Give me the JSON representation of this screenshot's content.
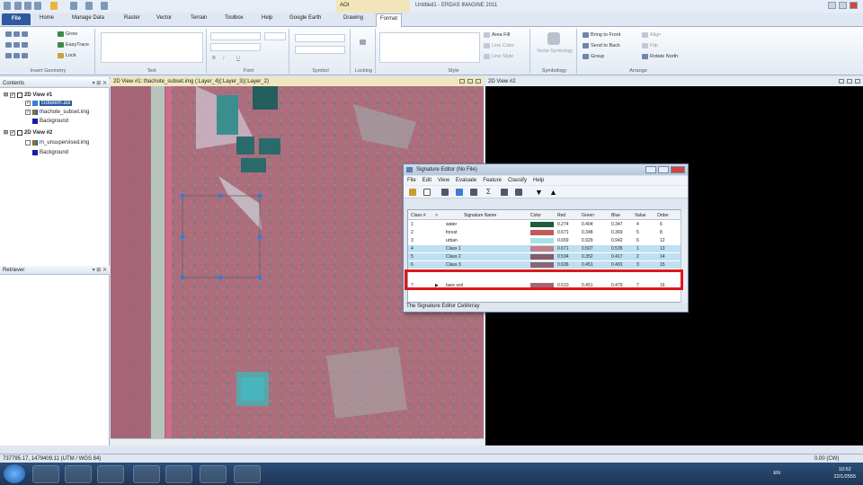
{
  "app": {
    "title": "Untitled1 - ERDAS IMAGINE 2011",
    "context_tab": "AOI"
  },
  "tabs": [
    "File",
    "Home",
    "Manage Data",
    "Raster",
    "Vector",
    "Terrain",
    "Toolbox",
    "Help",
    "Google Earth",
    "Drawing",
    "Format"
  ],
  "ribbon": {
    "insert_geometry": {
      "grow": "Grow",
      "easytrace": "EasyTrace",
      "lock": "Lock",
      "label": "Insert Geometry"
    },
    "text_label": "Text",
    "font_label": "Font",
    "font_b": "B",
    "font_i": "I",
    "font_u": "U",
    "symbol_label": "Symbol",
    "locking_label": "Locking",
    "style": {
      "area_fill": "Area Fill",
      "line_color": "Line Color",
      "line_style": "Line Style",
      "label": "Style"
    },
    "symbology": {
      "vector_symbology": "Vector Symbology",
      "label": "Symbology"
    },
    "arrange": {
      "bring_to_front": "Bring to Front",
      "send_to_back": "Send to Back",
      "group": "Group",
      "align": "Align",
      "flip": "Flip",
      "rotate_north": "Rotate North",
      "label": "Arrange"
    }
  },
  "contents": {
    "header": "Contents",
    "items": [
      {
        "label": "2D View #1",
        "level": 0
      },
      {
        "label": "Gotelem.aoi",
        "level": 1
      },
      {
        "label": "thachote_subset.img",
        "level": 1
      },
      {
        "label": "Background",
        "level": 1
      },
      {
        "label": "2D View #2",
        "level": 0
      },
      {
        "label": "m_unsupervised.img",
        "level": 1
      },
      {
        "label": "Background",
        "level": 1
      }
    ]
  },
  "retriever": {
    "header": "Retriever"
  },
  "view1": {
    "header": "2D View #1: thachote_subset.img (:Layer_4)(:Layer_3)(:Layer_2)"
  },
  "view2": {
    "header": "2D View #2"
  },
  "sig_editor": {
    "title": "Signature Editor (No File)",
    "menu": [
      "File",
      "Edit",
      "View",
      "Evaluate",
      "Feature",
      "Classify",
      "Help"
    ],
    "columns": [
      "Class #",
      ">",
      "Signature Name",
      "Color",
      "Red",
      "Green",
      "Blue",
      "Value",
      "Order"
    ],
    "rows": [
      {
        "num": "1",
        "sel": "",
        "name": "water",
        "color": "#1f5a3a",
        "red": "0.274",
        "green": "0.404",
        "blue": "0.347",
        "value": "4",
        "order": "6"
      },
      {
        "num": "2",
        "sel": "",
        "name": "forest",
        "color": "#c45a5a",
        "red": "0.671",
        "green": "0.348",
        "blue": "0.369",
        "value": "5",
        "order": "8"
      },
      {
        "num": "3",
        "sel": "",
        "name": "urban",
        "color": "#a8e3e8",
        "red": "0.659",
        "green": "0.929",
        "blue": "0.942",
        "value": "6",
        "order": "12"
      },
      {
        "num": "4",
        "sel": "",
        "name": "Class 1",
        "color": "#c67f87",
        "red": "0.671",
        "green": "0.507",
        "blue": "0.535",
        "value": "1",
        "order": "13"
      },
      {
        "num": "5",
        "sel": "",
        "name": "Class 2",
        "color": "#8a5a63",
        "red": "0.534",
        "green": "0.352",
        "blue": "0.417",
        "value": "2",
        "order": "14"
      },
      {
        "num": "6",
        "sel": "",
        "name": "Class 3",
        "color": "#8a6470",
        "red": "0.636",
        "green": "0.451",
        "blue": "0.491",
        "value": "3",
        "order": "15"
      },
      {
        "num": "7",
        "sel": "▶",
        "name": "bare soil",
        "color": "#9e6970",
        "red": "0.610",
        "green": "0.451",
        "blue": "0.479",
        "value": "7",
        "order": "16"
      }
    ],
    "status": "The Signature Editor CellArray"
  },
  "statusbar": {
    "coords": "737795.17, 1479409.11  (UTM / WGS 84)",
    "rotation": "0.00 (CW)"
  },
  "taskbar": {
    "lang": "EN",
    "time": "10:52",
    "date": "22/1/2555"
  }
}
